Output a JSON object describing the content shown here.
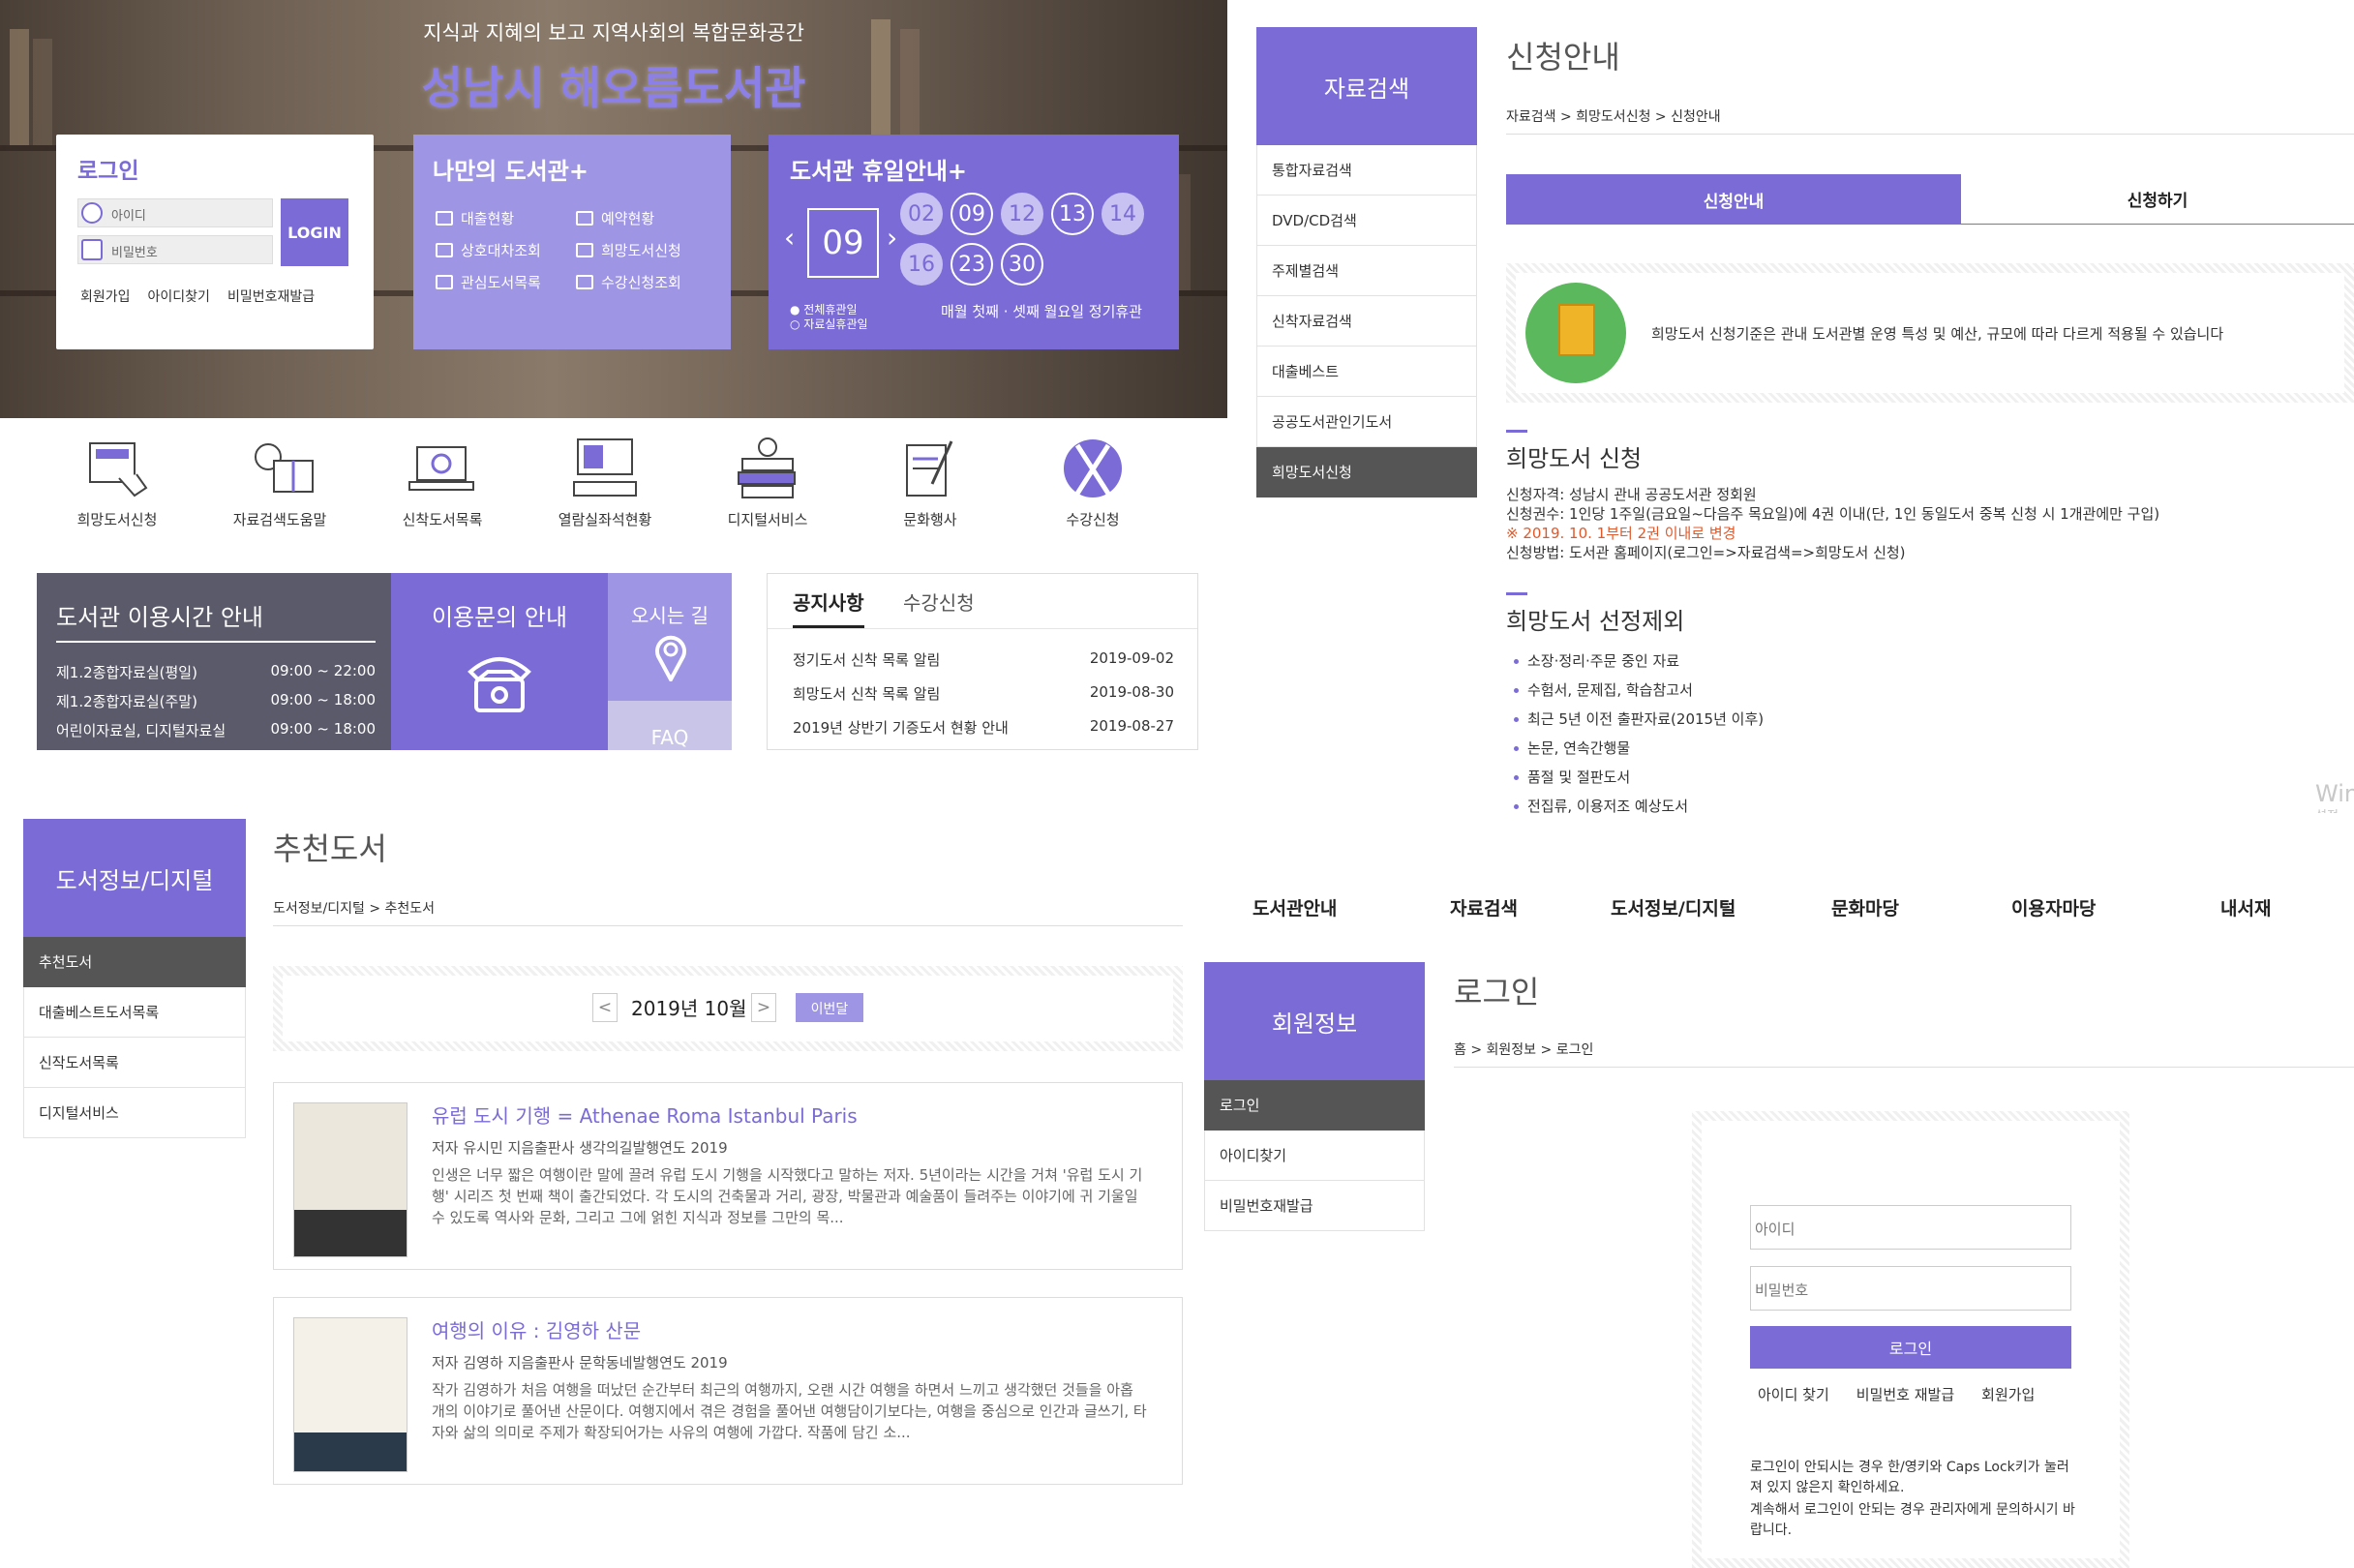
{
  "home": {
    "tagline": "지식과 지혜의 보고  지역사회의 복합문화공간",
    "title": "성남시 해오름도서관",
    "login": {
      "title": "로그인",
      "id_placeholder": "아이디",
      "pw_placeholder": "비밀번호",
      "button": "LOGIN",
      "links": [
        "회원가입",
        "아이디찾기",
        "비밀번호재발급"
      ]
    },
    "my_library": {
      "title": "나만의 도서관+",
      "items": [
        "대출현황",
        "예약현황",
        "상호대차조회",
        "희망도서신청",
        "관심도서목록",
        "수강신청조회"
      ]
    },
    "holiday": {
      "title": "도서관 휴일안내+",
      "month": "09",
      "days": [
        "02",
        "09",
        "12",
        "13",
        "14",
        "16",
        "23",
        "30"
      ],
      "legend": [
        "전체휴관일",
        "자료실휴관일"
      ],
      "note": "매월 첫째 · 셋째 월요일 정기휴관"
    },
    "quick_icons": [
      {
        "label": "희망도서신청",
        "icon": "book-hand-icon"
      },
      {
        "label": "자료검색도움말",
        "icon": "lightbulb-book-icon"
      },
      {
        "label": "신착도서목록",
        "icon": "laptop-mail-icon"
      },
      {
        "label": "열람실좌석현황",
        "icon": "computer-keyboard-icon"
      },
      {
        "label": "디지털서비스",
        "icon": "books-apple-icon"
      },
      {
        "label": "문화행사",
        "icon": "scroll-pen-icon"
      },
      {
        "label": "수강신청",
        "icon": "fork-knife-icon"
      }
    ],
    "hours": {
      "title": "도서관 이용시간 안내",
      "rows": [
        {
          "name": "제1.2종합자료실(평일)",
          "time": "09:00 ~ 22:00"
        },
        {
          "name": "제1.2종합자료실(주말)",
          "time": "09:00 ~ 18:00"
        },
        {
          "name": "어린이자료실, 디지털자료실",
          "time": "09:00 ~ 18:00"
        }
      ]
    },
    "inquiry": {
      "title": "이용문의 안내"
    },
    "directions": {
      "title": "오시는 길"
    },
    "faq": {
      "title": "FAQ"
    },
    "notice": {
      "tabs": [
        "공지사항",
        "수강신청"
      ],
      "rows": [
        {
          "title": "정기도서 신착 목록 알림",
          "date": "2019-09-02"
        },
        {
          "title": "희망도서 신착 목록 알림",
          "date": "2019-08-30"
        },
        {
          "title": "2019년 상반기 기증도서 현황 안내",
          "date": "2019-08-27"
        }
      ]
    }
  },
  "apply": {
    "side_title": "자료검색",
    "side_items": [
      "통합자료검색",
      "DVD/CD검색",
      "주제별검색",
      "신착자료검색",
      "대출베스트",
      "공공도서관인기도서",
      "희망도서신청"
    ],
    "title": "신청안내",
    "breadcrumb": [
      "자료검색",
      "희망도서신청",
      "신청안내"
    ],
    "tabs": [
      "신청안내",
      "신청하기"
    ],
    "info": "희망도서 신청기준은 관내 도서관별 운영 특성 및 예산, 규모에 따라 다르게 적용될 수 있습니다",
    "sec1": {
      "title": "희망도서 신청",
      "lines": [
        "신청자격: 성남시 관내 공공도서관 정회원",
        "신청권수: 1인당 1주일(금요일~다음주 목요일)에 4권 이내(단, 1인 동일도서 중복 신청 시 1개관에만 구입)",
        "※ 2019. 10. 1부터 2권 이내로 변경",
        "신청방법: 도서관 홈페이지(로그인=>자료검색=>희망도서 신청)"
      ]
    },
    "sec2": {
      "title": "희망도서 선정제외",
      "items": [
        "소장·정리·주문 중인 자료",
        "수험서, 문제집, 학습참고서",
        "최근 5년 이전 출판자료(2015년 이후)",
        "논문, 연속간행물",
        "품절 및 절판도서",
        "전집류, 이용저조 예상도서"
      ]
    },
    "watermark": [
      "Win",
      "설정"
    ]
  },
  "recommend": {
    "side_title": "도서정보/디지털",
    "side_items": [
      "추천도서",
      "대출베스트도서목록",
      "신작도서목록",
      "디지털서비스"
    ],
    "title": "추천도서",
    "breadcrumb": [
      "도서정보/디지털",
      "추천도서"
    ],
    "month": "2019년 10월",
    "this_month": "이번달",
    "prev": "<",
    "next": ">",
    "books": [
      {
        "title": "유럽 도시 기행 = Athenae Roma Istanbul Paris",
        "meta": "저자 유시민 지음출판사 생각의길발행연도 2019",
        "desc": "인생은 너무 짧은 여행이란 말에 끌려 유럽 도시 기행을 시작했다고 말하는 저자. 5년이라는 시간을 거쳐 '유럽 도시 기행' 시리즈 첫 번째 책이 출간되었다. 각 도시의 건축물과 거리, 광장, 박물관과 예술품이 들려주는 이야기에 귀 기울일 수 있도록 역사와 문화, 그리고 그에 얽힌 지식과 정보를 그만의 목..."
      },
      {
        "title": "여행의 이유 : 김영하 산문",
        "meta": "저자 김영하 지음출판사 문학동네발행연도 2019",
        "desc": "작가 김영하가 처음 여행을 떠났던 순간부터 최근의 여행까지, 오랜 시간 여행을 하면서 느끼고 생각했던 것들을 아홉 개의 이야기로 풀어낸 산문이다. 여행지에서 겪은 경험을 풀어낸 여행담이기보다는, 여행을 중심으로 인간과 글쓰기, 타자와 삶의 의미로 주제가 확장되어가는 사유의 여행에 가깝다. 작품에 담긴 소..."
      }
    ]
  },
  "member": {
    "gnb": [
      "도서관안내",
      "자료검색",
      "도서정보/디지털",
      "문화마당",
      "이용자마당",
      "내서재"
    ],
    "side_title": "회원정보",
    "side_items": [
      "로그인",
      "아이디찾기",
      "비밀번호재발급"
    ],
    "title": "로그인",
    "breadcrumb": [
      "홈",
      "회원정보",
      "로그인"
    ],
    "id_placeholder": "아이디",
    "pw_placeholder": "비밀번호",
    "button": "로그인",
    "links": [
      "아이디 찾기",
      "비밀번호 재발급",
      "회원가입"
    ],
    "help1": "로그인이 안되시는 경우 한/영키와 Caps Lock키가 눌러져 있지 않은지 확인하세요.",
    "help2": "계속해서 로그인이 안되는 경우 관리자에게 문의하시기 바랍니다."
  },
  "colors": {
    "accent": "#7a6bd6",
    "accent_light": "#9e95e4",
    "dark": "#5b5a6a",
    "warning": "#e0592a"
  }
}
